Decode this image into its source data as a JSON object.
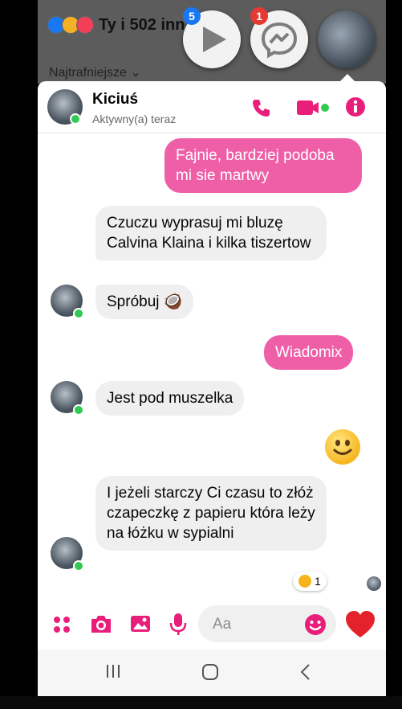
{
  "feed": {
    "reactions_text": "Ty i 502 inn...ych",
    "sort_label": "Najtrafniejsze"
  },
  "chat_heads": [
    {
      "name": "play-app",
      "badge": "5"
    },
    {
      "name": "messenger",
      "badge": "1"
    },
    {
      "name": "contact-avatar",
      "badge": ""
    }
  ],
  "conversation": {
    "contact_name": "Kiciuś",
    "contact_status": "Aktywny(a) teraz",
    "messages": [
      {
        "from": "me",
        "text": "Fajnie, bardziej podoba mi sie martwy"
      },
      {
        "from": "them",
        "text": "Czuczu wyprasuj mi bluzę Calvina Klaina i kilka tiszertow"
      },
      {
        "from": "them",
        "text": "Spróbuj 🥥"
      },
      {
        "from": "me",
        "text": "Wiadomix"
      },
      {
        "from": "them",
        "text": "Jest pod muszelka"
      },
      {
        "from": "me",
        "text": "🙂",
        "type": "emoji"
      },
      {
        "from": "them",
        "text": "I jeżeli starczy Ci czasu to złóż czapeczkę z papieru która leży na łóżku w sypialni"
      }
    ],
    "reaction": {
      "emoji": "heart-eyes",
      "count": "1"
    }
  },
  "composer": {
    "placeholder": "Aa"
  },
  "colors": {
    "accent": "#e91e7a",
    "outgoing_bubble": "#ef5fa7",
    "incoming_bubble": "#efefef",
    "online": "#31c952"
  }
}
